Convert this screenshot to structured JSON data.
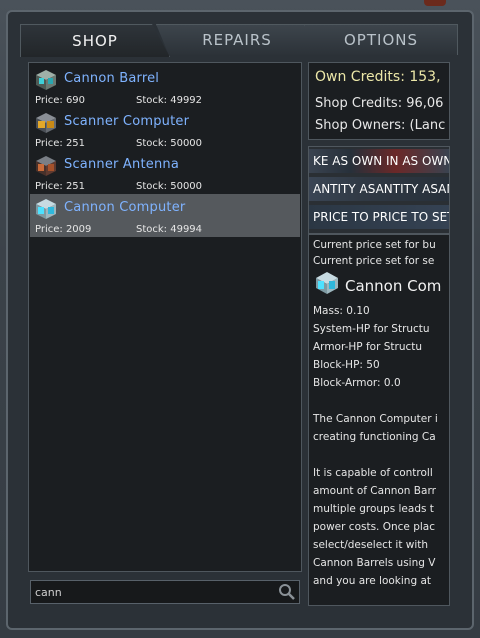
{
  "tabs": [
    {
      "label": "SHOP"
    },
    {
      "label": "REPAIRS"
    },
    {
      "label": "OPTIONS"
    }
  ],
  "items": [
    {
      "name": "Cannon Barrel",
      "price": "Price: 690",
      "stock": "Stock: 49992",
      "icon": "cannon-barrel-block-icon"
    },
    {
      "name": "Scanner Computer",
      "price": "Price: 251",
      "stock": "Stock: 50000",
      "icon": "scanner-computer-block-icon"
    },
    {
      "name": "Scanner Antenna",
      "price": "Price: 251",
      "stock": "Stock: 50000",
      "icon": "scanner-antenna-block-icon"
    },
    {
      "name": "Cannon Computer",
      "price": "Price: 2009",
      "stock": "Stock: 49994",
      "icon": "cannon-computer-block-icon",
      "selected": true
    }
  ],
  "search": {
    "value": "cann",
    "icon": "search-icon"
  },
  "credits": {
    "own": "Own Credits: 153,",
    "shop": "Shop Credits: 96,06",
    "owners": "Shop Owners: (Lanc"
  },
  "buttons": {
    "b1": "KE AS OWN IN AS OWN IN",
    "b2": "ANTITY ASANTITY ASANTITY",
    "b3": "PRICE TO PRICE TO SET"
  },
  "description": {
    "line1": "Current price set for bu",
    "line2": "Current price set for se",
    "title": "Cannon Com",
    "mass": "Mass: 0.10",
    "system_hp": "System-HP for Structu",
    "armor_hp": "Armor-HP  for Structu",
    "block_hp": "Block-HP: 50",
    "block_armor": "Block-Armor: 0.0",
    "p1a": "The Cannon Computer i",
    "p1b": "creating functioning Ca",
    "p2a": "It is capable of controll",
    "p2b": "amount of Cannon Barr",
    "p2c": "multiple groups leads t",
    "p2d": "power costs. Once plac",
    "p2e": "select/deselect it with",
    "p2f": "Cannon Barrels using V",
    "p2g": "and you are looking at "
  },
  "colors": {
    "accent_link": "#7fb3ff",
    "credits_highlight": "#ece7a8",
    "selected_row": "#55595d"
  }
}
